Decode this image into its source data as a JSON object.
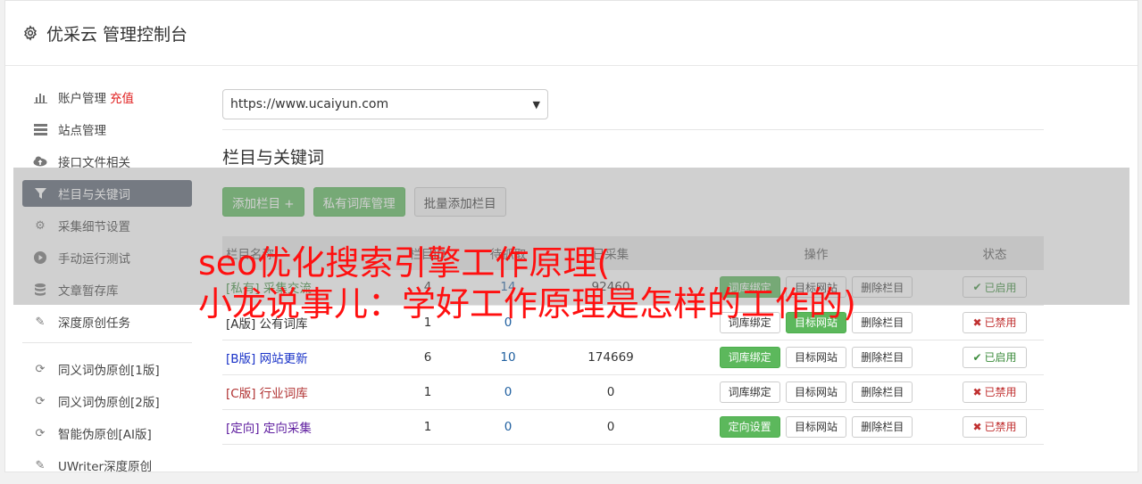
{
  "header": {
    "title": "优采云 管理控制台",
    "icon": "gear-icon"
  },
  "sidebar": {
    "items": [
      {
        "label": "账户管理",
        "extra": "充值",
        "icon": "bar-chart-icon"
      },
      {
        "label": "站点管理",
        "icon": "server-icon"
      },
      {
        "label": "接口文件相关",
        "icon": "cloud-upload-icon"
      },
      {
        "label": "栏目与关键词",
        "icon": "filter-icon",
        "active": true
      },
      {
        "label": "采集细节设置",
        "icon": "cogs-icon"
      },
      {
        "label": "手动运行测试",
        "icon": "play-circle-icon"
      },
      {
        "label": "文章暂存库",
        "icon": "database-icon"
      },
      {
        "label": "深度原创任务",
        "icon": "edit-icon"
      }
    ],
    "items2": [
      {
        "label": "同义词伪原创[1版]",
        "icon": "refresh-icon"
      },
      {
        "label": "同义词伪原创[2版]",
        "icon": "refresh-icon"
      },
      {
        "label": "智能伪原创[AI版]",
        "icon": "refresh-icon"
      },
      {
        "label": "UWriter深度原创",
        "icon": "edit-icon"
      }
    ]
  },
  "main": {
    "site_select": "https://www.ucaiyun.com",
    "section_title": "栏目与关键词",
    "toolbar": {
      "add": "添加栏目 +",
      "private_lib": "私有词库管理",
      "batch_add": "批量添加栏目"
    },
    "table": {
      "headers": [
        "栏目名称",
        "栏目ID",
        "待抓取",
        "已采集",
        "操作",
        "状态"
      ],
      "rows": [
        {
          "name": "[私有] 采集交流",
          "id": "4",
          "pending": "14",
          "collected": "92460",
          "op1": "词库绑定",
          "op2": "目标网站",
          "op3": "删除栏目",
          "status": "已启用"
        },
        {
          "name": "[A版] 公有词库",
          "id": "1",
          "pending": "0",
          "collected": "",
          "op1": "词库绑定",
          "op2": "目标网站",
          "op3": "删除栏目",
          "status": "已禁用"
        },
        {
          "name": "[B版] 网站更新",
          "id": "6",
          "pending": "10",
          "collected": "174669",
          "op1": "词库绑定",
          "op2": "目标网站",
          "op3": "删除栏目",
          "status": "已启用"
        },
        {
          "name": "[C版] 行业词库",
          "id": "1",
          "pending": "0",
          "collected": "0",
          "op1": "词库绑定",
          "op2": "目标网站",
          "op3": "删除栏目",
          "status": "已禁用"
        },
        {
          "name": "[定向] 定向采集",
          "id": "1",
          "pending": "0",
          "collected": "0",
          "op1": "定向设置",
          "op2": "目标网站",
          "op3": "删除栏目",
          "status": "已禁用"
        }
      ]
    }
  },
  "watermark": {
    "line1": "seo优化搜索引擎工作原理(",
    "line2": "小龙说事儿：学好工作原理是怎样的工作的)"
  },
  "colors": {
    "primary_green": "#5cb85c",
    "active_nav": "#5a6372",
    "watermark_red": "#ff1010"
  }
}
